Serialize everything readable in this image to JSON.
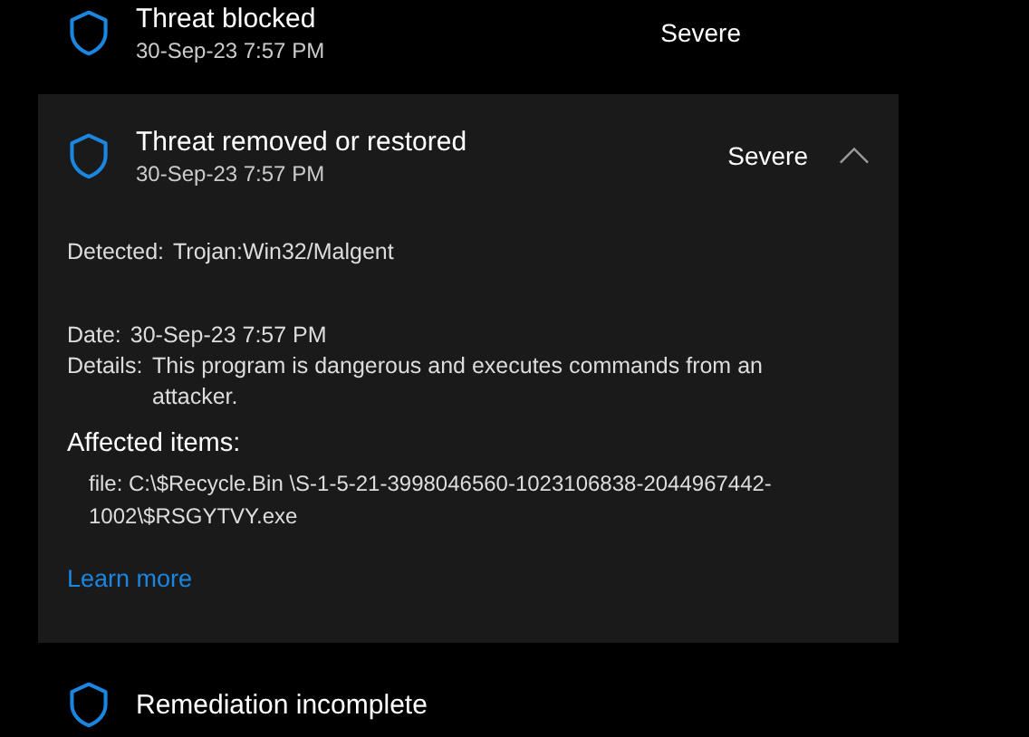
{
  "threats": [
    {
      "title": "Threat blocked",
      "date": "30-Sep-23 7:57 PM",
      "severity": "Severe",
      "expanded": false
    },
    {
      "title": "Threat removed or restored",
      "date": "30-Sep-23 7:57 PM",
      "severity": "Severe",
      "expanded": true,
      "details": {
        "detected_label": "Detected:",
        "detected": "Trojan:Win32/Malgent",
        "date_label": "Date:",
        "date": "30-Sep-23 7:57 PM",
        "details_label": "Details:",
        "details": "This program is dangerous and executes commands from an attacker.",
        "affected_heading": "Affected items:",
        "affected_items": [
          "file: C:\\$Recycle.Bin \\S-1-5-21-3998046560-1023106838-2044967442-1002\\$RSGYTVY.exe"
        ],
        "link": "Learn more"
      }
    },
    {
      "title": "Remediation incomplete",
      "expanded": false
    }
  ]
}
